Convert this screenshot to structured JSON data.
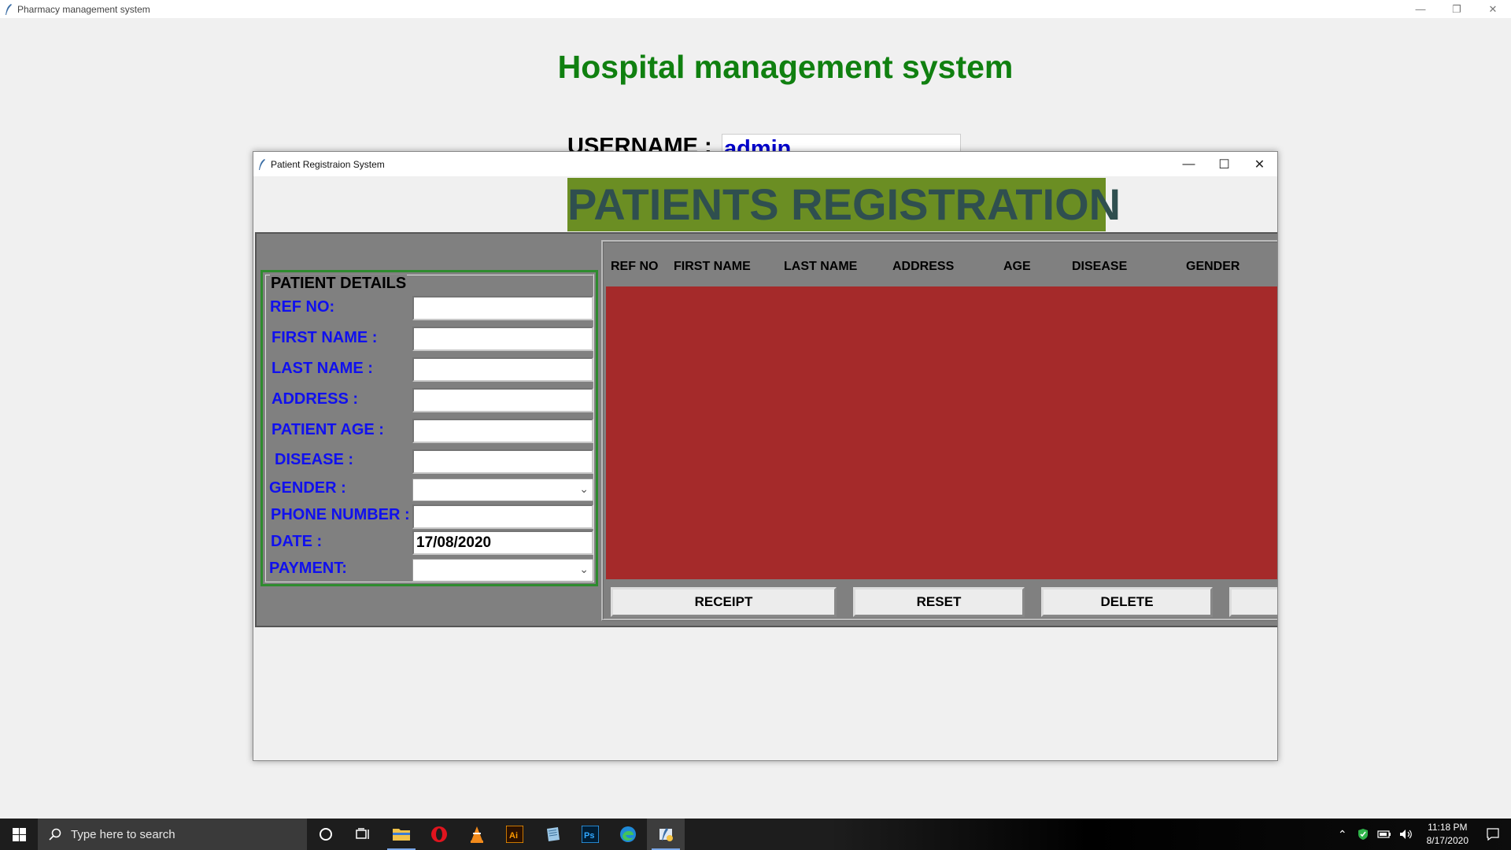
{
  "main_window": {
    "title": "Pharmacy management system",
    "heading": "Hospital management system",
    "username_label": "USERNAME :",
    "username_value": "admin"
  },
  "dialog": {
    "title": "Patient Registraion System",
    "banner": "PATIENTS REGISTRATION"
  },
  "details": {
    "legend": "PATIENT DETAILS",
    "ref_no_label": "REF NO:",
    "first_name_label": "FIRST NAME :",
    "last_name_label": "LAST NAME :",
    "address_label": "ADDRESS :",
    "age_label": "PATIENT AGE :",
    "disease_label": "DISEASE :",
    "gender_label": "GENDER :",
    "phone_label": "PHONE NUMBER :",
    "date_label": "DATE :",
    "date_value": "17/08/2020",
    "payment_label": "PAYMENT:"
  },
  "table": {
    "columns": [
      "REF NO",
      "FIRST NAME",
      "LAST NAME",
      "ADDRESS",
      "AGE",
      "DISEASE",
      "GENDER"
    ],
    "rows": []
  },
  "buttons": {
    "receipt": "RECEIPT",
    "reset": "RESET",
    "delete": "DELETE"
  },
  "taskbar": {
    "search_placeholder": "Type here to search",
    "time": "11:18 PM",
    "date": "8/17/2020"
  },
  "colors": {
    "heading": "#108010",
    "banner_bg": "#6b8e23",
    "banner_text": "#2f4f4f",
    "label_blue": "#1010ee",
    "table_body": "#a52a2a",
    "frame_gray": "#808080"
  }
}
